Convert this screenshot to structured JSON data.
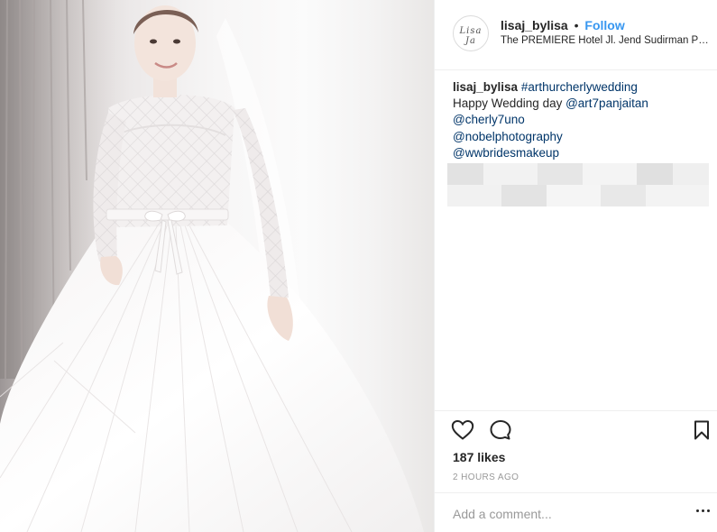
{
  "post": {
    "image_alt": "Bride in a lace-sleeved ball gown with a satin bow belt"
  },
  "header": {
    "avatar_text": "Lisa Ja",
    "username": "lisaj_bylisa",
    "separator": "•",
    "follow_label": "Follow",
    "location": "The PREMIERE Hotel Jl. Jend Sudirman Pekanbaru"
  },
  "caption": {
    "username": "lisaj_bylisa",
    "hashtag": "#arthurcherlywedding",
    "text": "Happy Wedding day ",
    "mention_1": "@art7panjaitan",
    "mention_2": "@cherly7uno",
    "mention_3": "@nobelphotography",
    "mention_4": "@wwbridesmakeup"
  },
  "actions": {
    "like_icon": "heart-outline",
    "comment_icon": "speech-bubble",
    "save_icon": "bookmark-outline"
  },
  "stats": {
    "likes": "187 likes",
    "time": "2 HOURS AGO"
  },
  "comment": {
    "placeholder": "Add a comment...",
    "more_icon": "ellipsis-horizontal"
  },
  "colors": {
    "link": "#3897f0",
    "caption_link": "#003569",
    "muted": "#999999",
    "divider": "#efefef"
  }
}
